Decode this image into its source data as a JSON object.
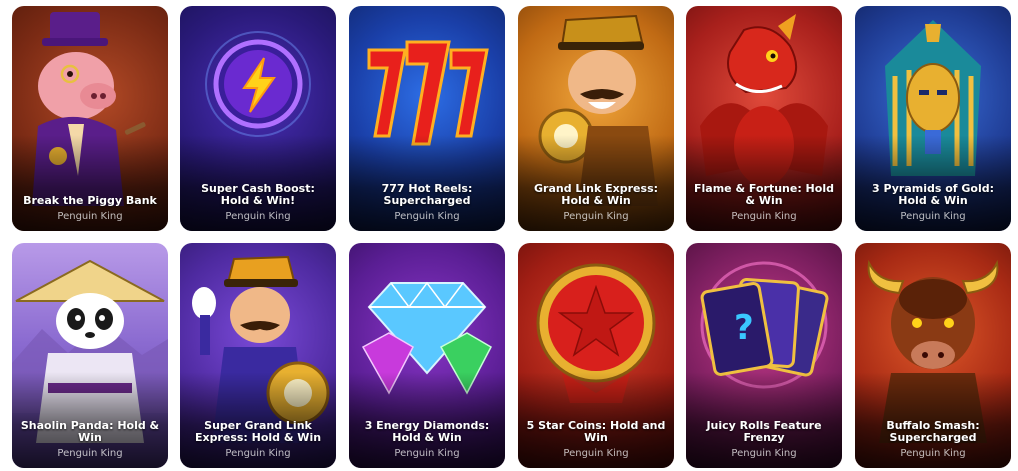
{
  "games": [
    {
      "title": "Break the Piggy Bank",
      "provider": "Penguin King",
      "art_icon": "piggy-banker-icon",
      "accent": "#7a2a14"
    },
    {
      "title": "Super Cash Boost: Hold & Win!",
      "provider": "Penguin King",
      "art_icon": "lightning-coin-icon",
      "accent": "#2a1a7a"
    },
    {
      "title": "777 Hot Reels: Supercharged",
      "provider": "Penguin King",
      "art_icon": "sevens-icon",
      "accent": "#1a3fa8"
    },
    {
      "title": "Grand Link Express: Hold & Win",
      "provider": "Penguin King",
      "art_icon": "train-conductor-icon",
      "accent": "#c06a14"
    },
    {
      "title": "Flame & Fortune: Hold & Win",
      "provider": "Penguin King",
      "art_icon": "red-dragon-icon",
      "accent": "#a8201c"
    },
    {
      "title": "3 Pyramids of Gold: Hold & Win",
      "provider": "Penguin King",
      "art_icon": "pharaoh-mask-icon",
      "accent": "#1f3c94"
    },
    {
      "title": "Shaolin Panda: Hold & Win",
      "provider": "Penguin King",
      "art_icon": "panda-monk-icon",
      "accent": "#8a6ad0"
    },
    {
      "title": "Super Grand Link Express: Hold & Win",
      "provider": "Penguin King",
      "art_icon": "train-conductor-waving-icon",
      "accent": "#4e2aa0"
    },
    {
      "title": "3 Energy Diamonds: Hold & Win",
      "provider": "Penguin King",
      "art_icon": "diamonds-icon",
      "accent": "#5a1e94"
    },
    {
      "title": "5 Star Coins: Hold and Win",
      "provider": "Penguin King",
      "art_icon": "star-coin-icon",
      "accent": "#a01e14"
    },
    {
      "title": "Juicy Rolls Feature Frenzy",
      "provider": "Penguin King",
      "art_icon": "mystery-cards-icon",
      "accent": "#7a1e5e"
    },
    {
      "title": "Buffalo Smash: Supercharged",
      "provider": "Penguin King",
      "art_icon": "buffalo-head-icon",
      "accent": "#a82a14"
    }
  ]
}
